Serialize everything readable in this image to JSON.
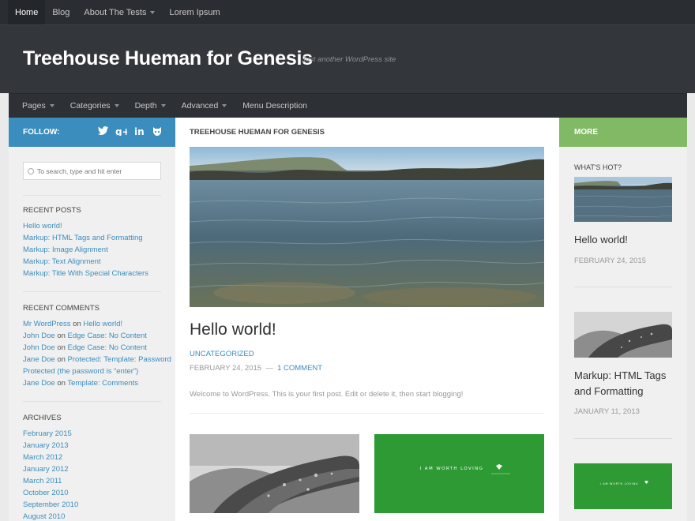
{
  "topnav": {
    "items": [
      {
        "label": "Home"
      },
      {
        "label": "Blog"
      },
      {
        "label": "About The Tests"
      },
      {
        "label": "Lorem Ipsum"
      }
    ]
  },
  "header": {
    "title": "Treehouse Hueman for Genesis",
    "tagline": "Just another WordPress site"
  },
  "subnav": {
    "items": [
      {
        "label": "Pages"
      },
      {
        "label": "Categories"
      },
      {
        "label": "Depth"
      },
      {
        "label": "Advanced"
      },
      {
        "label": "Menu Description"
      }
    ]
  },
  "left_sidebar": {
    "follow_label": "FOLLOW:",
    "social": [
      "twitter-icon",
      "google-plus-icon",
      "linkedin-icon",
      "github-icon"
    ],
    "search_placeholder": "To search, type and hit enter",
    "recent_posts": {
      "title": "RECENT POSTS",
      "items": [
        "Hello world!",
        "Markup: HTML Tags and Formatting",
        "Markup: Image Alignment",
        "Markup: Text Alignment",
        "Markup: Title With Special Characters"
      ]
    },
    "recent_comments": {
      "title": "RECENT COMMENTS",
      "on_word": "on",
      "items": [
        {
          "author": "Mr WordPress",
          "post": "Hello world!"
        },
        {
          "author": "John Doe",
          "post": "Edge Case: No Content"
        },
        {
          "author": "John Doe",
          "post": "Edge Case: No Content"
        },
        {
          "author": "Jane Doe",
          "post": "Protected: Template: Password Protected (the password is “enter”)"
        },
        {
          "author": "Jane Doe",
          "post": "Template: Comments"
        }
      ]
    },
    "archives": {
      "title": "ARCHIVES",
      "items": [
        "February 2015",
        "January 2013",
        "March 2012",
        "January 2012",
        "March 2011",
        "October 2010",
        "September 2010",
        "August 2010"
      ]
    }
  },
  "main": {
    "heading": "TREEHOUSE HUEMAN FOR GENESIS",
    "post": {
      "title": "Hello world!",
      "category": "UNCATEGORIZED",
      "date": "FEBRUARY 24, 2015",
      "separator": "—",
      "comments": "1 COMMENT",
      "excerpt": "Welcome to WordPress. This is your first post. Edit or delete it, then start blogging!"
    },
    "thumb_text": "I AM WORTH LOVING"
  },
  "right_sidebar": {
    "title": "MORE",
    "whats_hot": "WHAT'S HOT?",
    "items": [
      {
        "title": "Hello world!",
        "date": "FEBRUARY 24, 2015"
      },
      {
        "title": "Markup: HTML Tags and Formatting",
        "date": "JANUARY 11, 2013"
      }
    ],
    "thumb_text": "I AM WORTH LOVING"
  },
  "colors": {
    "accent_blue": "#3b8dbd",
    "accent_green": "#82b965",
    "dark_header": "#33363b"
  }
}
